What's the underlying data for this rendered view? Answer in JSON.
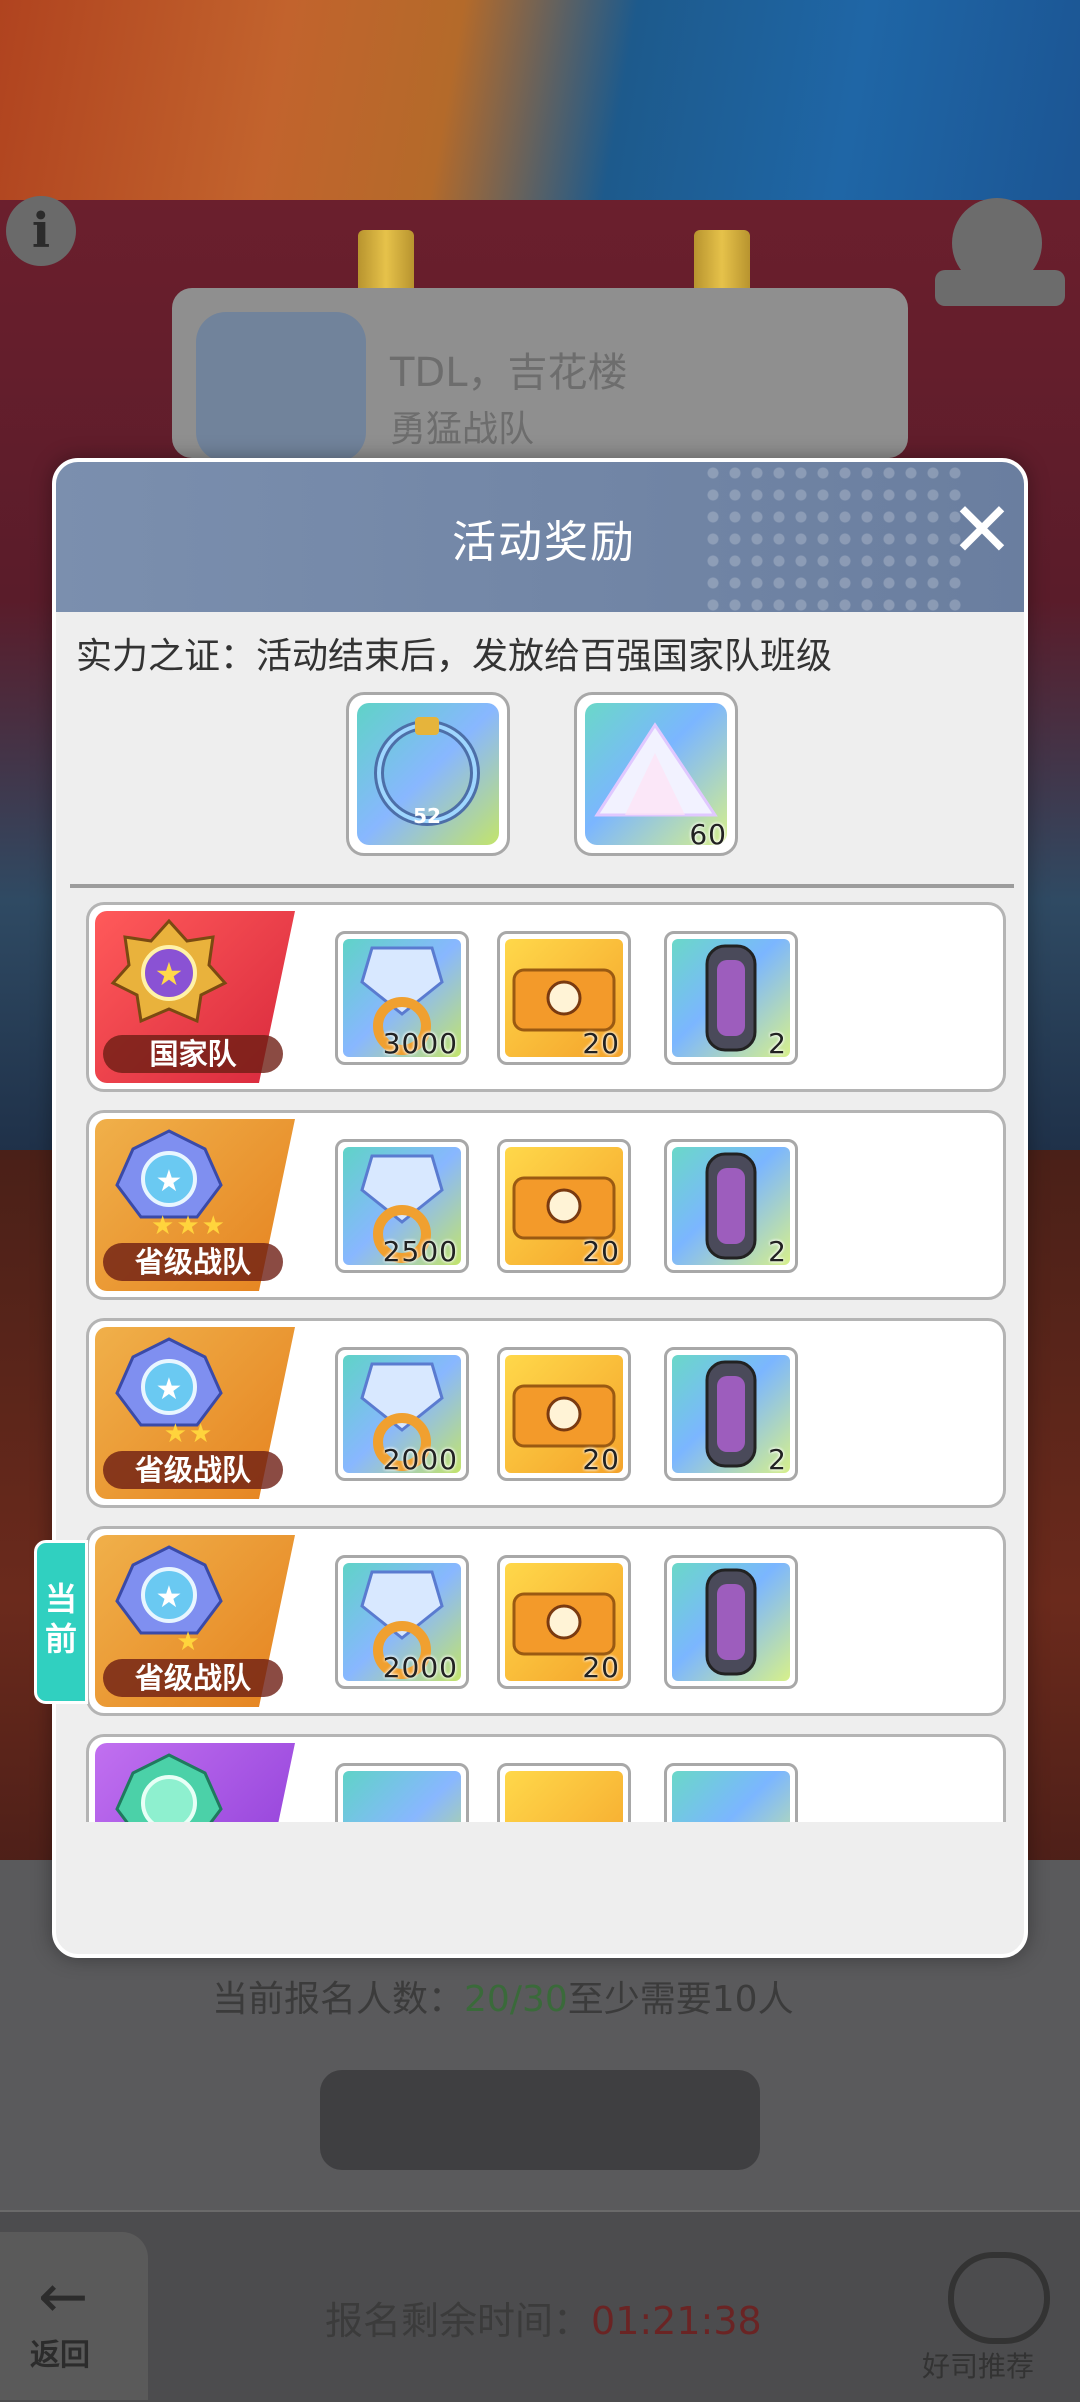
{
  "background": {
    "profile_name": "TDL，吉花楼",
    "profile_sub": "勇猛战队",
    "signup_count_prefix": "当前报名人数：",
    "signup_count_value": "20/30",
    "signup_count_suffix": "至少需要10人",
    "remaining_label": "报名剩余时间：",
    "remaining_time": "01:21:38",
    "back_label": "返回",
    "team_label": "好司推荐"
  },
  "modal": {
    "title": "活动奖励",
    "close_glyph": "✕",
    "subtitle": "实力之证：活动结束后，发放给百强国家队班级",
    "top_rewards": [
      {
        "name": "frame",
        "qty": ""
      },
      {
        "name": "crystal-pile",
        "qty": "60"
      }
    ]
  },
  "rows": [
    {
      "rank_label": "国家队",
      "stars": "",
      "color": "#e53a4a",
      "items": [
        "3000",
        "20",
        "2"
      ]
    },
    {
      "rank_label": "省级战队",
      "stars": "★★★",
      "color": "#ec9a33",
      "items": [
        "2500",
        "20",
        "2"
      ]
    },
    {
      "rank_label": "省级战队",
      "stars": "★★",
      "color": "#ec9a33",
      "items": [
        "2000",
        "20",
        "2"
      ]
    },
    {
      "rank_label": "省级战队",
      "stars": "★",
      "color": "#ec9a33",
      "items": [
        "2000",
        "20",
        ""
      ]
    },
    {
      "rank_label": "",
      "stars": "",
      "color": "#a24ee0",
      "items": [
        "",
        "",
        ""
      ]
    }
  ],
  "current_tag": "当前"
}
